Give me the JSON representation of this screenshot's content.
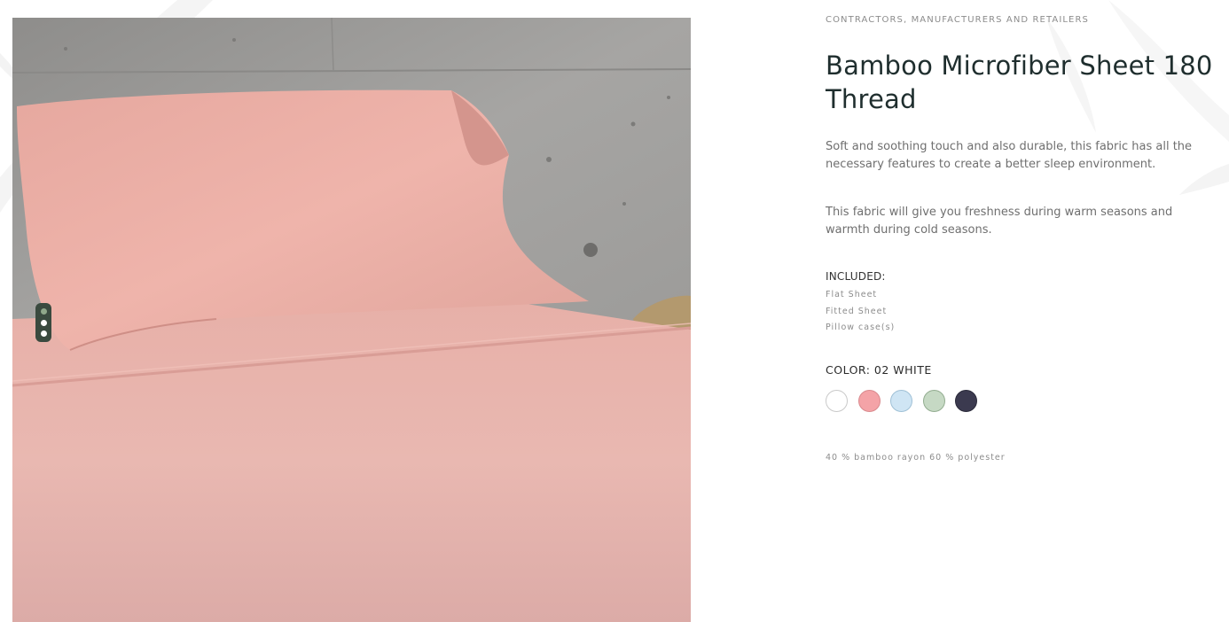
{
  "product": {
    "eyebrow": "CONTRACTORS, MANUFACTURERS AND RETAILERS",
    "title": "Bamboo Microfiber Sheet 180 Thread",
    "description_1": "Soft and soothing touch and also durable, this fabric has all the necessary features to create a better sleep environment.",
    "description_2": "This fabric will give you freshness during warm seasons and warmth during cold seasons.",
    "included_label": "INCLUDED:",
    "included_items": [
      "Flat Sheet",
      "Fitted Sheet",
      "Pillow case(s)"
    ],
    "color_label": "COLOR: 02 WHITE",
    "composition": "40 % bamboo rayon 60 % polyester"
  },
  "swatches": [
    {
      "name": "white",
      "color": "#ffffff",
      "border": "#c9c9c9"
    },
    {
      "name": "pink",
      "color": "#f4a3a7",
      "border": "#d98a8e"
    },
    {
      "name": "light-blue",
      "color": "#cfe5f4",
      "border": "#9fc0d6"
    },
    {
      "name": "sage-green",
      "color": "#c6d9c4",
      "border": "#93ad90"
    },
    {
      "name": "navy",
      "color": "#3b3a4f",
      "border": "#2a2a3a"
    }
  ],
  "gallery": {
    "slides": 3,
    "active_slide": 1
  },
  "icons": {
    "background": "bamboo-leaf-icon"
  },
  "colors": {
    "title": "#1f2e2e",
    "muted_text": "#8c8c8c",
    "body_text": "#6f6f6f",
    "sheet_pink": "#e8b1ac",
    "wall_concrete": "#a9a8a6"
  }
}
